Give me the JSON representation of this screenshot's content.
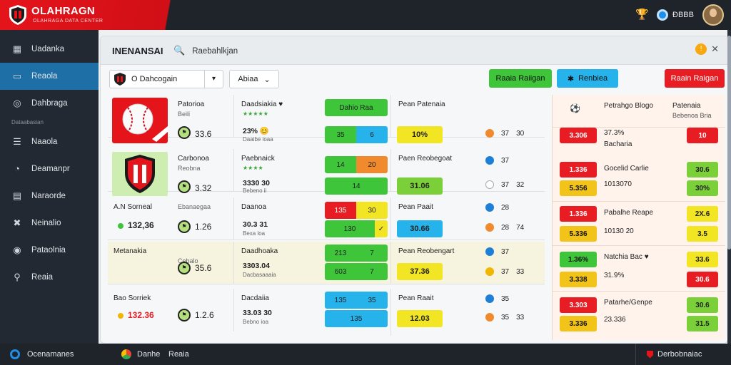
{
  "brand": {
    "title": "OLAHRAGN",
    "subtitle": "OLAHRAGA DATA CENTER",
    "shield_icon": "shield-icon"
  },
  "topbar": {
    "user_label": "ĐBBB"
  },
  "sidebar": {
    "items": [
      {
        "label": "Uadanka",
        "icon": "grid-icon"
      },
      {
        "label": "Reaola",
        "icon": "sports-icon"
      },
      {
        "label": "Dahbraga",
        "icon": "globe-icon"
      },
      {
        "label": "Naaola",
        "icon": "list-icon"
      },
      {
        "label": "Deamanpr",
        "icon": "shield-icon"
      },
      {
        "label": "Naraorde",
        "icon": "chart-icon"
      },
      {
        "label": "Neinalio",
        "icon": "team-icon"
      },
      {
        "label": "Pataolnia",
        "icon": "settings-icon"
      },
      {
        "label": "Reaia",
        "icon": "user-icon"
      }
    ],
    "section_label": "Dataabasian"
  },
  "panel": {
    "title": "INENANSAI",
    "search_placeholder": "Raebahlkjan"
  },
  "toolbar": {
    "league": "O Dahcogain",
    "sort": "Abiaa",
    "btn_green": "Raaia Raiigan",
    "btn_blue": "Renbiea",
    "btn_red": "Raain Raigan"
  },
  "rows": [
    {
      "name": "Patorioa",
      "sub": "Beili",
      "score": "33.6",
      "c2_name": "Daadsiakia ♥",
      "c2_stars": "★★★★★",
      "c2_val": "23% 😊",
      "c2_sub": "Daaibe ioaa",
      "odds_top": "Dahio Raa",
      "odds": [
        "35",
        "6"
      ],
      "c4_name": "Pean Patenaia",
      "c4_val": "10%",
      "c4_mini_a": "37",
      "c4_mini_b": "30"
    },
    {
      "name": "Carbonoa",
      "sub": "Reobna",
      "score": "3.32",
      "c2_name": "Paebnaick",
      "c2_stars": "★★★★",
      "c2_val": "3330 30",
      "c2_sub": "Bebeno ii",
      "odds": [
        "14",
        "20"
      ],
      "c4_name": "Paen Reobegoat",
      "c4_val": "31.06",
      "c4_mini_a": "37",
      "c4_mini_b": "32"
    },
    {
      "name": "A.N Sorneal",
      "sub": "Ebanaegaa",
      "score": "132,36",
      "c2_name": "Daanoa",
      "c2_stars": "",
      "c2_val": "30.3 31",
      "c2_sub": "Bexa loa",
      "odds": [
        "135",
        "30"
      ],
      "odds2": "130",
      "c4_name": "Pean Paait",
      "c4_val": "30.66",
      "c4_mini_a": "28",
      "c4_mini_b": "74"
    },
    {
      "name": "Metanakia",
      "sub": "Cebalo",
      "score": "35.6",
      "c2_name": "Daadhoaka",
      "c2_stars": "",
      "c2_val": "3303.04",
      "c2_sub": "Dacbasaaaia",
      "odds": [
        "213",
        "7"
      ],
      "odds2": "603",
      "c4_name": "Pean Reobengart",
      "c4_val": "37.36",
      "c4_mini_a": "37",
      "c4_mini_b": "33"
    },
    {
      "name": "Bao Sorriek",
      "sub": "",
      "score": "132.36",
      "c2_name": "Dacdaiia",
      "c2_stars": "",
      "c2_val": "33.03 30",
      "c2_sub": "Bebno ioa",
      "odds": [
        "135",
        "35"
      ],
      "odds2": "135",
      "c4_name": "Pean Raait",
      "c4_val": "12.03",
      "c4_mini_a": "35",
      "c4_mini_b": "33"
    }
  ],
  "right": {
    "head_name": "Petrahgo Blogo",
    "head_val": "Patenaia",
    "head_sub": "Bebenoa Bria",
    "rows": [
      {
        "box": "3.306",
        "txt": "37.3%",
        "txt2": "Bacharia",
        "chip": "10"
      },
      {
        "box": "1.336",
        "txt": "Gocelid Carlie",
        "txt2": "1013070",
        "chip": "30.6",
        "box2": "5.356",
        "chip2": "30%"
      },
      {
        "box": "1.336",
        "txt": "Pabalhe Reape",
        "txt2": "10130 20",
        "chip": "2X.6",
        "box2": "5.336",
        "chip2": "3.5"
      },
      {
        "box": "1.36%",
        "txt": "Natchia Bac ♥",
        "txt2": "31.9%",
        "chip": "33.6",
        "box2": "3.338",
        "chip2": "30.6"
      },
      {
        "box": "3.303",
        "txt": "Patarhe/Genpe",
        "txt2": "23.336",
        "chip": "30.6",
        "box2": "3.336",
        "chip2": "31.5"
      }
    ]
  },
  "footer": {
    "left": "Ocenamanes",
    "mid": "Danhe",
    "mid2": "Reaia",
    "right": "Derbobnaiac"
  },
  "colors": {
    "brand_red": "#e5141b",
    "sidebar": "#232932",
    "active": "#1e6fa6",
    "green": "#3ec53a",
    "blue": "#26b2ea",
    "yellow": "#f2e524",
    "orange": "#f08a2c"
  }
}
